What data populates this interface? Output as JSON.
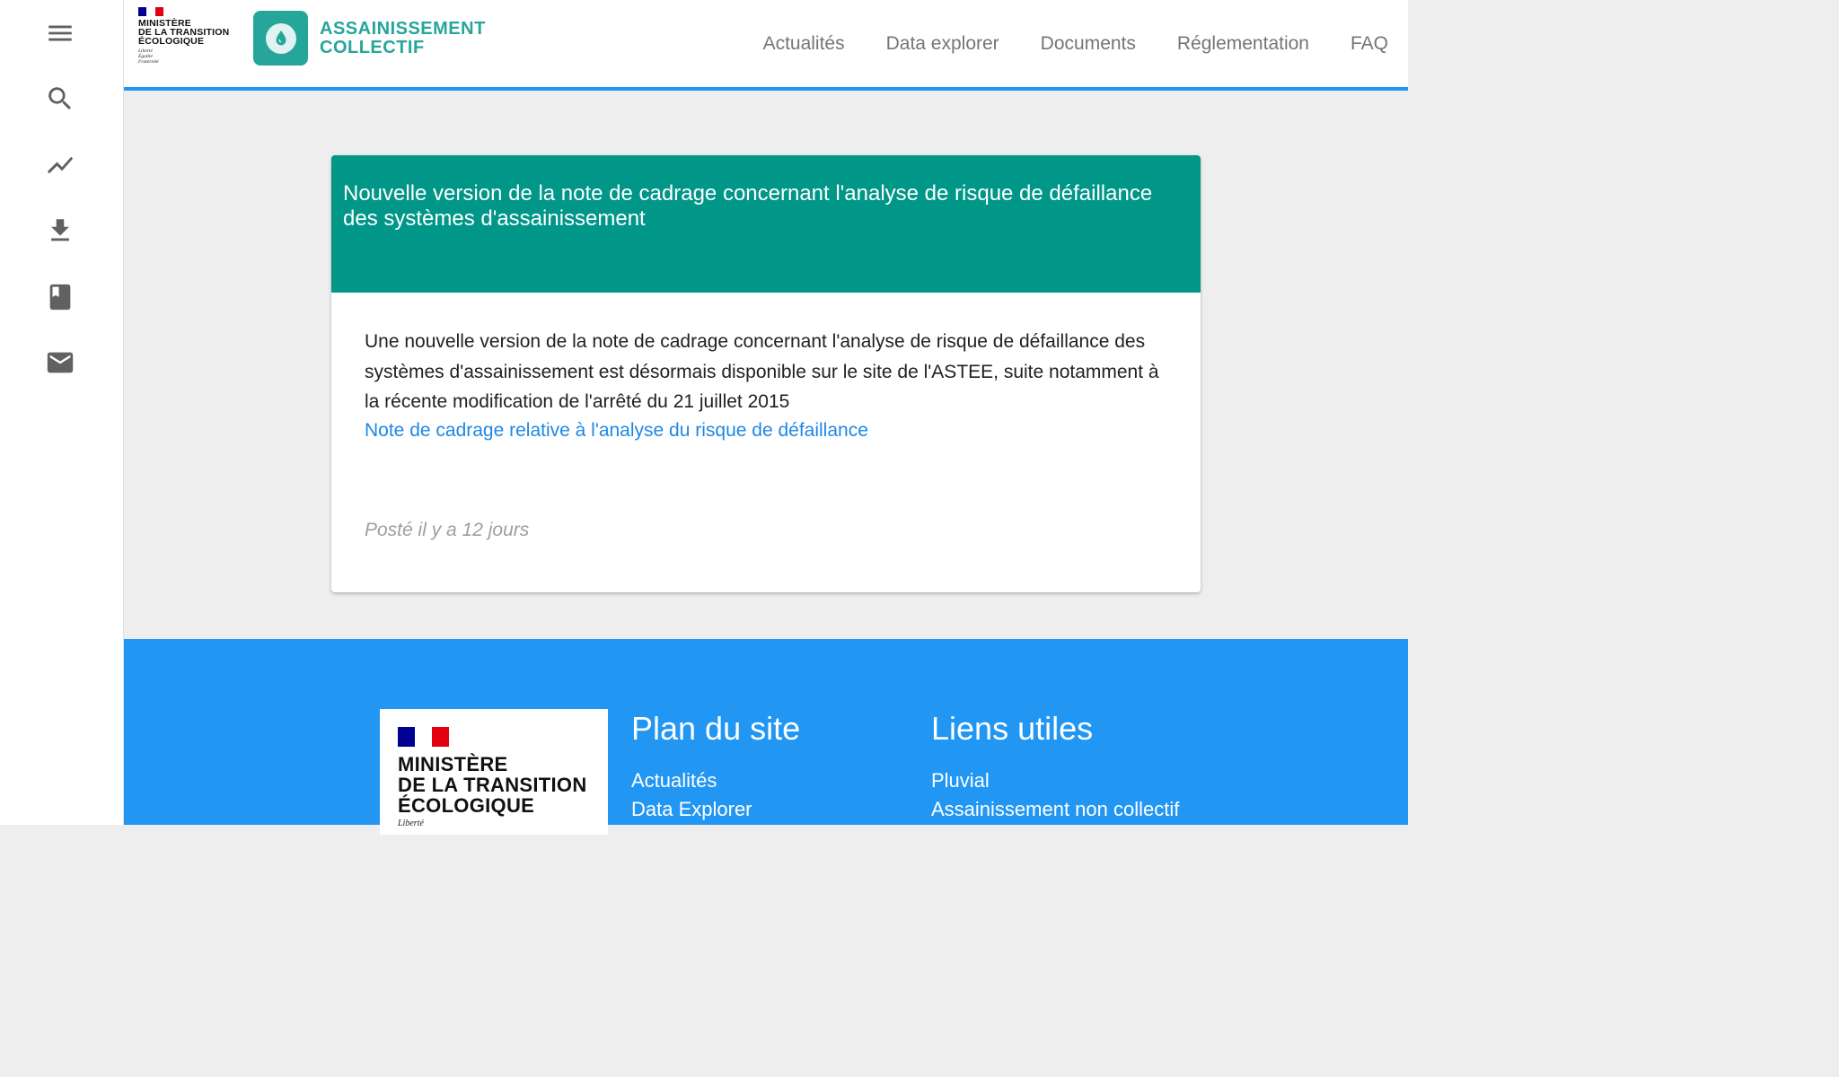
{
  "sidebar": {
    "items": [
      {
        "icon": "menu-icon"
      },
      {
        "icon": "search-icon"
      },
      {
        "icon": "trending-icon"
      },
      {
        "icon": "download-icon"
      },
      {
        "icon": "book-icon"
      },
      {
        "icon": "mail-icon"
      }
    ]
  },
  "header": {
    "gov_logo": {
      "lines": [
        "MINISTÈRE",
        "DE LA TRANSITION",
        "ÉCOLOGIQUE"
      ],
      "motto": [
        "Liberté",
        "Égalité",
        "Fraternité"
      ]
    },
    "app_name_line1": "ASSAINISSEMENT",
    "app_name_line2": "COLLECTIF",
    "nav": [
      "Actualités",
      "Data explorer",
      "Documents",
      "Réglementation",
      "FAQ"
    ]
  },
  "card": {
    "title": "Nouvelle version de la note de cadrage concernant l'analyse de risque de défaillance des systèmes d'assainissement",
    "body": "Une nouvelle version de la note de cadrage concernant l'analyse de risque de défaillance des systèmes d'assainissement est désormais disponible sur le site de l'ASTEE, suite notamment à la récente modification de l'arrêté du 21 juillet 2015",
    "link": "Note de cadrage relative à l'analyse du risque de défaillance",
    "posted": "Posté il y a 12 jours"
  },
  "footer": {
    "logo": {
      "line1": "MINISTÈRE",
      "line2": "DE LA TRANSITION",
      "line3": "ÉCOLOGIQUE",
      "motto": "Liberté"
    },
    "plan_title": "Plan du site",
    "plan_links": [
      "Actualités",
      "Data Explorer"
    ],
    "useful_title": "Liens utiles",
    "useful_links": [
      "Pluvial",
      "Assainissement non collectif"
    ]
  },
  "colors": {
    "accent_blue": "#2196f3",
    "teal": "#009688",
    "app_teal": "#26a69a",
    "link_blue": "#1e88e5",
    "flag_blue": "#000091",
    "flag_red": "#e1000f"
  }
}
